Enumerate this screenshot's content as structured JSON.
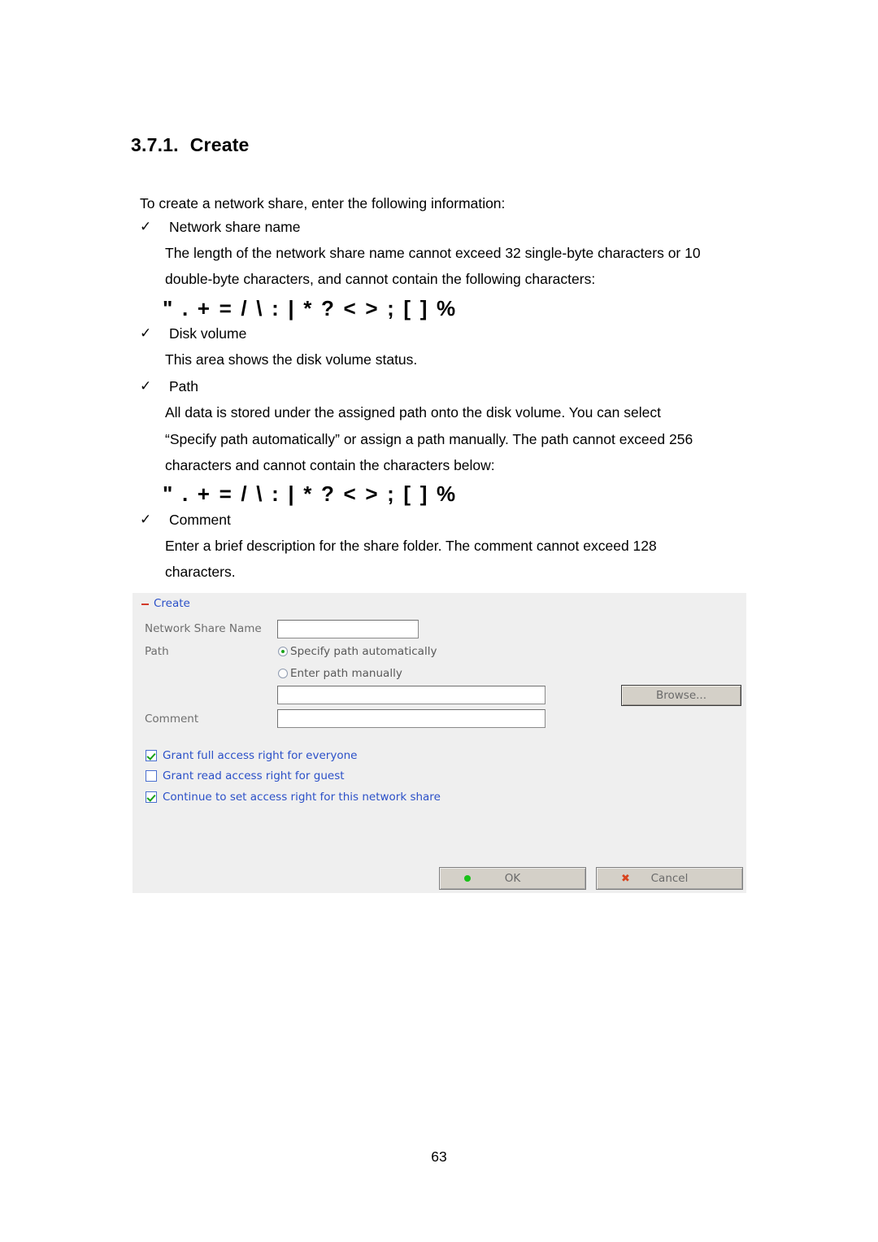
{
  "document": {
    "heading_number": "3.7.1.",
    "heading_title": "Create",
    "intro": "To create a network share, enter the following information:",
    "tick_glyph": "✓",
    "bullets": [
      {
        "label": "Network share name",
        "lines": [
          "The length of the network share name cannot exceed 32 single-byte characters or 10",
          "double-byte characters, and cannot contain the following characters:"
        ],
        "symbols": "\" . + = / \\ : | * ? < > ; [ ] %"
      },
      {
        "label": "Disk volume",
        "lines": [
          "This area shows the disk volume status."
        ],
        "symbols": null
      },
      {
        "label": "Path",
        "lines": [
          "All data is stored under the assigned path onto the disk volume.  You can select",
          "“Specify path automatically” or assign a path manually.  The path cannot exceed 256",
          "characters and cannot contain the characters below:"
        ],
        "symbols": "\" . + = / \\ : | * ? < > ; [ ] %"
      },
      {
        "label": "Comment",
        "lines": [
          "Enter a brief description for the share folder.  The comment cannot exceed 128",
          "characters."
        ],
        "symbols": null
      }
    ],
    "page_number": "63"
  },
  "dialog": {
    "panel_title": "Create",
    "labels": {
      "network_share_name": "Network Share Name",
      "path": "Path",
      "comment": "Comment"
    },
    "inputs": {
      "network_share_name_value": "",
      "path_value": "",
      "comment_value": ""
    },
    "radios": [
      {
        "label": "Specify path automatically",
        "selected": true
      },
      {
        "label": "Enter path manually",
        "selected": false
      }
    ],
    "browse_label": "Browse...",
    "checkboxes": [
      {
        "label": "Grant full access right for everyone",
        "checked": true
      },
      {
        "label": "Grant read access right for guest",
        "checked": false
      },
      {
        "label": "Continue to set access right for this network share",
        "checked": true
      }
    ],
    "buttons": {
      "ok_label": "OK",
      "cancel_label": "Cancel",
      "cancel_glyph": "✖"
    },
    "colors": {
      "panel_bg": "#efefef",
      "link_blue": "#2b50c8",
      "minus_red": "#d23a2a",
      "ok_green": "#19c219",
      "cancel_red": "#d8441f"
    }
  }
}
